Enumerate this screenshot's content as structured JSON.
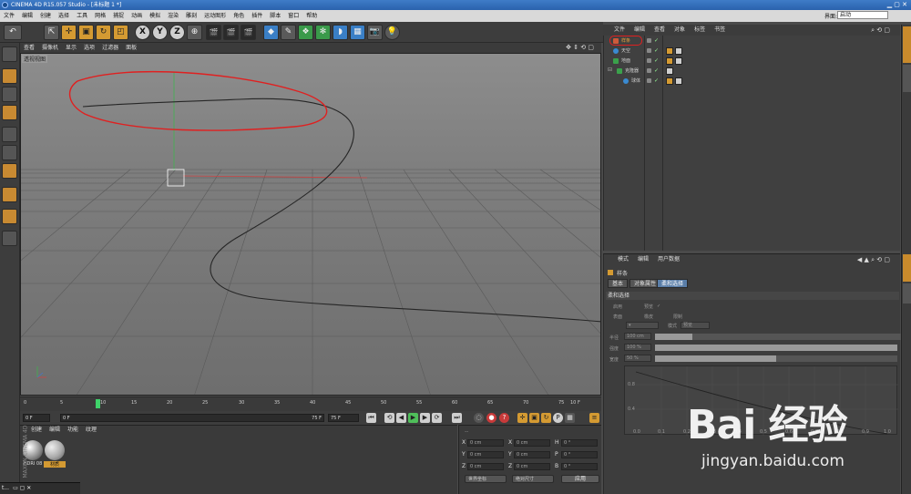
{
  "window": {
    "title": "CINEMA 4D R15.057 Studio - [未标题 1 *]"
  },
  "menubar": [
    "文件",
    "编辑",
    "创建",
    "选择",
    "工具",
    "网格",
    "捕捉",
    "动画",
    "模拟",
    "渲染",
    "雕刻",
    "运动图形",
    "角色",
    "插件",
    "脚本",
    "窗口",
    "帮助"
  ],
  "toolbar": {
    "undo": "↶",
    "axis_labels": [
      "X",
      "Y",
      "Z"
    ]
  },
  "viewport": {
    "menus": [
      "查看",
      "摄像机",
      "显示",
      "选项",
      "过滤器",
      "面板"
    ],
    "label": "透视视图"
  },
  "timeline": {
    "ticks": [
      "0",
      "5",
      "10",
      "15",
      "20",
      "25",
      "30",
      "35",
      "40",
      "45",
      "50",
      "55",
      "60",
      "65",
      "70",
      "75"
    ],
    "end_label": "10 F",
    "current_frame": 10,
    "total_frames": 75
  },
  "transport": {
    "start_field": "0 F",
    "range_start": "0 F",
    "range_end": "75 F",
    "range_end2": "75 F"
  },
  "material_panel": {
    "menus": [
      "创建",
      "编辑",
      "功能",
      "纹理"
    ],
    "materials": [
      {
        "name": "HDRI 08"
      },
      {
        "name": "材质"
      }
    ],
    "brand": "MAXON CINEMA 4D"
  },
  "coord_panel": {
    "rows": [
      {
        "axis": "X",
        "pos": "0 cm",
        "size": "0 cm",
        "rot_axis": "H",
        "rot": "0 °"
      },
      {
        "axis": "Y",
        "pos": "0 cm",
        "size": "0 cm",
        "rot_axis": "P",
        "rot": "0 °"
      },
      {
        "axis": "Z",
        "pos": "0 cm",
        "size": "0 cm",
        "rot_axis": "B",
        "rot": "0 °"
      }
    ],
    "dropdown_left": "世界坐标",
    "dropdown_right": "绝对尺寸",
    "apply_label": "应用"
  },
  "object_manager": {
    "layout_label": "界面:",
    "layout_value": "启动",
    "menus": [
      "文件",
      "编辑",
      "查看",
      "对象",
      "标签",
      "书签"
    ],
    "objects": [
      {
        "name": "样条",
        "indent": 0,
        "selected": true,
        "icon_color": "#cf5a3a"
      },
      {
        "name": "天空",
        "indent": 0,
        "selected": false,
        "icon_color": "#3a8ad1"
      },
      {
        "name": "地面",
        "indent": 0,
        "selected": false,
        "icon_color": "#3aa14b"
      },
      {
        "name": "克隆器",
        "indent": 1,
        "selected": false,
        "icon_color": "#3aa14b"
      },
      {
        "name": "球体",
        "indent": 2,
        "selected": false,
        "icon_color": "#3a8ad1"
      }
    ]
  },
  "attribute_manager": {
    "menus": [
      "模式",
      "编辑",
      "用户数据"
    ],
    "object_name": "样条",
    "tabs": [
      "基本",
      "对象属性",
      "柔和选择"
    ],
    "section_title": "柔和选择",
    "fields": [
      {
        "label": "启用",
        "value": ""
      },
      {
        "label": "预览",
        "value": "✓"
      },
      {
        "label": "表面",
        "value": ""
      },
      {
        "label": "橡皮",
        "value": ""
      },
      {
        "label": "限制",
        "value": ""
      },
      {
        "label": "模式",
        "value": "预览"
      }
    ],
    "sliders": [
      {
        "label": "半径",
        "value": "100 cm",
        "fill": 0.15
      },
      {
        "label": "强度",
        "value": "100 %",
        "fill": 1.0
      },
      {
        "label": "宽度",
        "value": "50 %",
        "fill": 0.5
      }
    ],
    "graph": {
      "yticks": [
        "0.8",
        "0.4"
      ],
      "xticks": [
        "0.0",
        "0.1",
        "0.2",
        "0.3",
        "0.4",
        "0.5",
        "0.6",
        "0.7",
        "0.8",
        "0.9",
        "1.0"
      ]
    }
  },
  "watermark": {
    "line1": "Bai 经验",
    "line2": "jingyan.baidu.com"
  },
  "taskbar": {
    "label": "t..."
  },
  "colors": {
    "accent_orange": "#d49a32",
    "annotation_red": "#e02020",
    "playhead_green": "#3fd36a"
  }
}
